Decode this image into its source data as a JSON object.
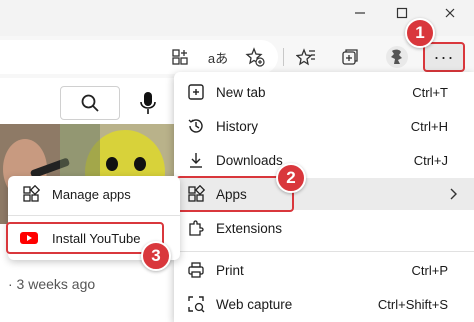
{
  "window": {
    "minimize_icon": "minimize-icon",
    "maximize_icon": "maximize-icon",
    "close_icon": "close-icon"
  },
  "toolbar": {
    "icons": [
      "app-grid-plus-icon",
      "read-aloud-icon",
      "favorite-add-icon",
      "favorites-icon",
      "collections-icon",
      "profile-icon"
    ],
    "read_aloud_text": "aあ",
    "more_label": "···"
  },
  "page": {
    "meta_text": "· 3 weeks ago"
  },
  "menu": {
    "items": [
      {
        "label": "New tab",
        "shortcut": "Ctrl+T"
      },
      {
        "label": "History",
        "shortcut": "Ctrl+H"
      },
      {
        "label": "Downloads",
        "shortcut": "Ctrl+J"
      },
      {
        "label": "Apps",
        "shortcut": ""
      },
      {
        "label": "Extensions",
        "shortcut": ""
      },
      {
        "label": "Print",
        "shortcut": "Ctrl+P"
      },
      {
        "label": "Web capture",
        "shortcut": "Ctrl+Shift+S"
      }
    ]
  },
  "submenu": {
    "items": [
      {
        "label": "Manage apps"
      },
      {
        "label": "Install YouTube"
      }
    ]
  },
  "badges": [
    "1",
    "2",
    "3"
  ],
  "colors": {
    "highlight": "#d9373c",
    "youtube": "#ff0000"
  }
}
